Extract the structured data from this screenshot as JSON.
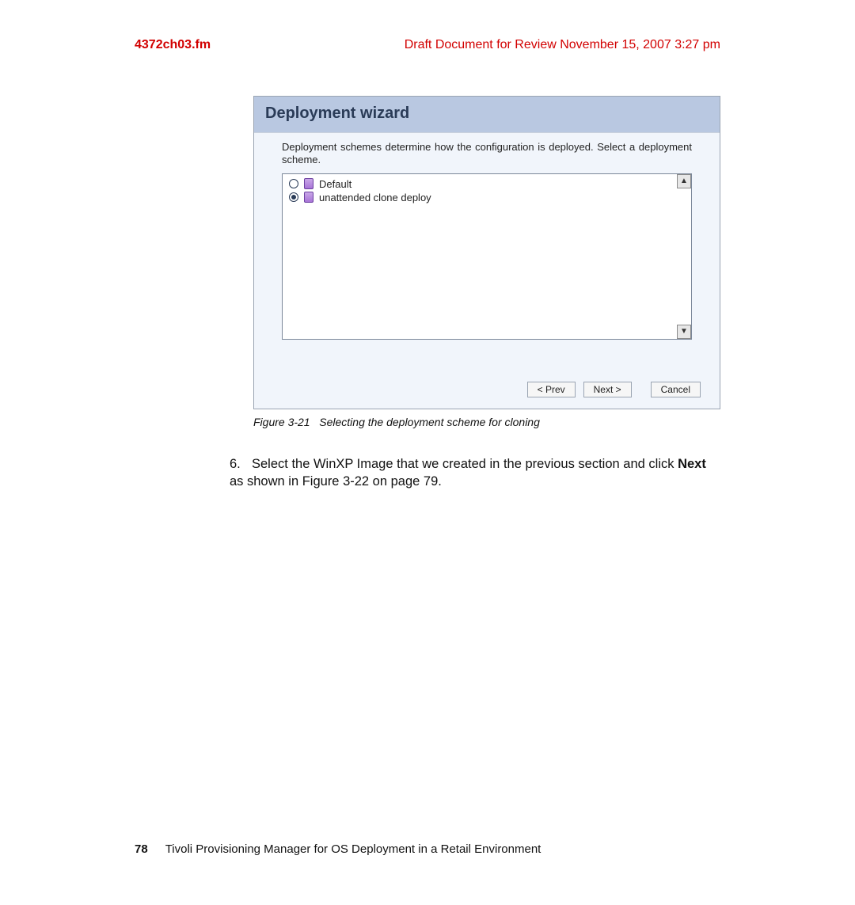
{
  "header": {
    "filename": "4372ch03.fm",
    "draft_note": "Draft Document for Review November 15, 2007 3:27 pm"
  },
  "wizard": {
    "title": "Deployment wizard",
    "description": "Deployment schemes determine how the configuration is deployed. Select a deployment scheme.",
    "schemes": [
      {
        "label": "Default",
        "selected": false
      },
      {
        "label": "unattended clone deploy",
        "selected": true
      }
    ],
    "buttons": {
      "prev": "< Prev",
      "next": "Next >",
      "cancel": "Cancel"
    }
  },
  "caption": {
    "label": "Figure 3-21",
    "text": "Selecting the deployment scheme for cloning"
  },
  "step": {
    "number": "6.",
    "part1": "Select the WinXP Image that we created in the previous section and click ",
    "bold": "Next",
    "part2": " as shown in Figure 3-22 on page 79."
  },
  "footer": {
    "page_number": "78",
    "book_title": "Tivoli Provisioning Manager for OS Deployment in a Retail Environment"
  }
}
